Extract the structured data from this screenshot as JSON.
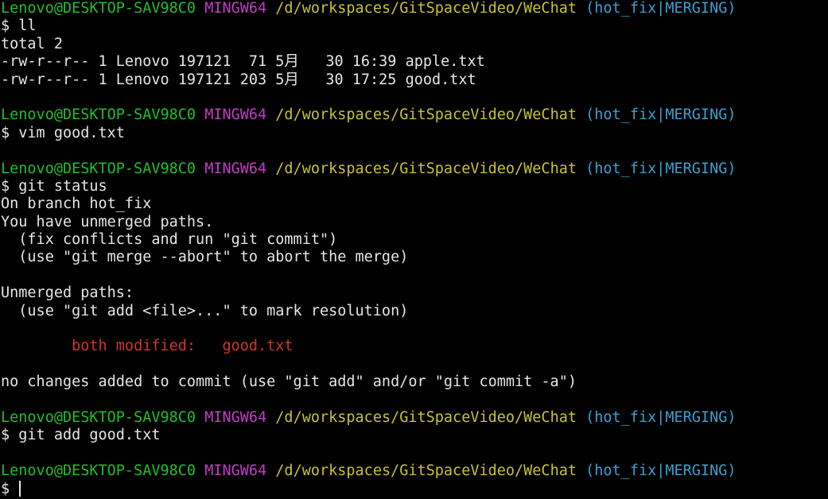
{
  "prompt": {
    "user": "Lenovo@DESKTOP-SAV98C0",
    "system": "MINGW64",
    "path": "/d/workspaces/GitSpaceVideo/WeChat",
    "branch": "(hot_fix|MERGING)",
    "symbol": "$"
  },
  "blocks": [
    {
      "command": "ll",
      "output": [
        "total 2",
        "-rw-r--r-- 1 Lenovo 197121  71 5月   30 16:39 apple.txt",
        "-rw-r--r-- 1 Lenovo 197121 203 5月   30 17:25 good.txt"
      ]
    },
    {
      "command": "vim good.txt",
      "output": []
    },
    {
      "command": "git status",
      "output": [
        "On branch hot_fix",
        "You have unmerged paths.",
        "  (fix conflicts and run \"git commit\")",
        "  (use \"git merge --abort\" to abort the merge)",
        "",
        "Unmerged paths:",
        "  (use \"git add <file>...\" to mark resolution)",
        ""
      ],
      "conflict": {
        "label": "        both modified:   ",
        "file": "good.txt"
      },
      "output_after": [
        "",
        "no changes added to commit (use \"git add\" and/or \"git commit -a\")"
      ]
    },
    {
      "command": "git add good.txt",
      "output": []
    }
  ],
  "current_input": "",
  "colors": {
    "user": "#1fbf2a",
    "system": "#c43bc7",
    "path": "#c9c233",
    "branch": "#3aa0d0",
    "conflict": "#d0362b",
    "text": "#e6e6e6",
    "background": "#000000"
  }
}
